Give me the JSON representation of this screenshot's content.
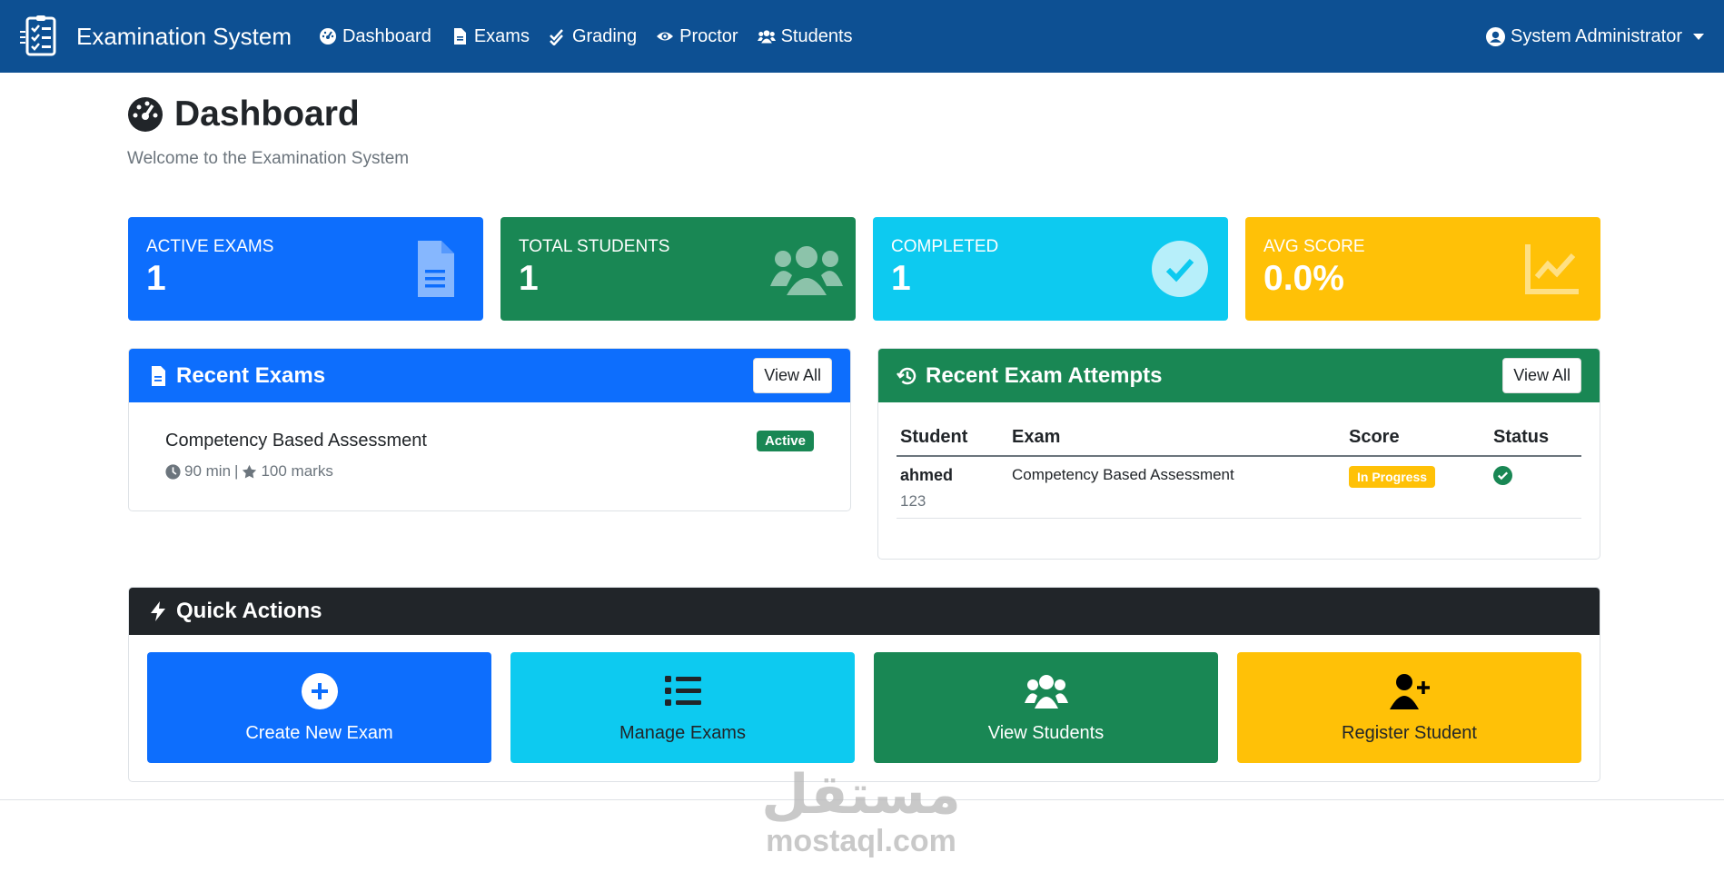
{
  "navbar": {
    "brand": "Examination System",
    "items": [
      {
        "label": "Dashboard",
        "icon": "gauge-icon"
      },
      {
        "label": "Exams",
        "icon": "file-icon"
      },
      {
        "label": "Grading",
        "icon": "check-double-icon"
      },
      {
        "label": "Proctor",
        "icon": "eye-icon"
      },
      {
        "label": "Students",
        "icon": "users-icon"
      }
    ],
    "user": "System Administrator"
  },
  "header": {
    "title": "Dashboard",
    "subtitle": "Welcome to the Examination System"
  },
  "stats": [
    {
      "label": "ACTIVE EXAMS",
      "value": "1",
      "color": "#0d6efd",
      "icon": "file-lines-icon"
    },
    {
      "label": "TOTAL STUDENTS",
      "value": "1",
      "color": "#198754",
      "icon": "users-icon"
    },
    {
      "label": "COMPLETED",
      "value": "1",
      "color": "#0dcaf0",
      "icon": "check-circle-icon"
    },
    {
      "label": "AVG SCORE",
      "value": "0.0%",
      "color": "#ffc107",
      "icon": "chart-line-icon"
    }
  ],
  "recent_exams": {
    "title": "Recent Exams",
    "view_all": "View All",
    "items": [
      {
        "name": "Competency Based Assessment",
        "duration": "90 min",
        "separator": "|",
        "marks": "100 marks",
        "status": "Active"
      }
    ]
  },
  "recent_attempts": {
    "title": "Recent Exam Attempts",
    "view_all": "View All",
    "columns": [
      "Student",
      "Exam",
      "Score",
      "Status"
    ],
    "rows": [
      {
        "student": "ahmed",
        "student_id": "123",
        "exam": "Competency Based Assessment",
        "score": "In Progress",
        "status_icon": "check-circle-icon"
      }
    ]
  },
  "quick_actions": {
    "title": "Quick Actions",
    "buttons": [
      {
        "label": "Create New Exam",
        "icon": "plus-circle-icon"
      },
      {
        "label": "Manage Exams",
        "icon": "list-icon"
      },
      {
        "label": "View Students",
        "icon": "users-icon"
      },
      {
        "label": "Register Student",
        "icon": "user-plus-icon"
      }
    ]
  },
  "watermark": {
    "arabic": "مستقل",
    "latin": "mostaql.com"
  },
  "colors": {
    "navbar": "#0d5093",
    "primary": "#0d6efd",
    "success": "#198754",
    "info": "#0dcaf0",
    "warning": "#ffc107",
    "dark": "#212529"
  }
}
